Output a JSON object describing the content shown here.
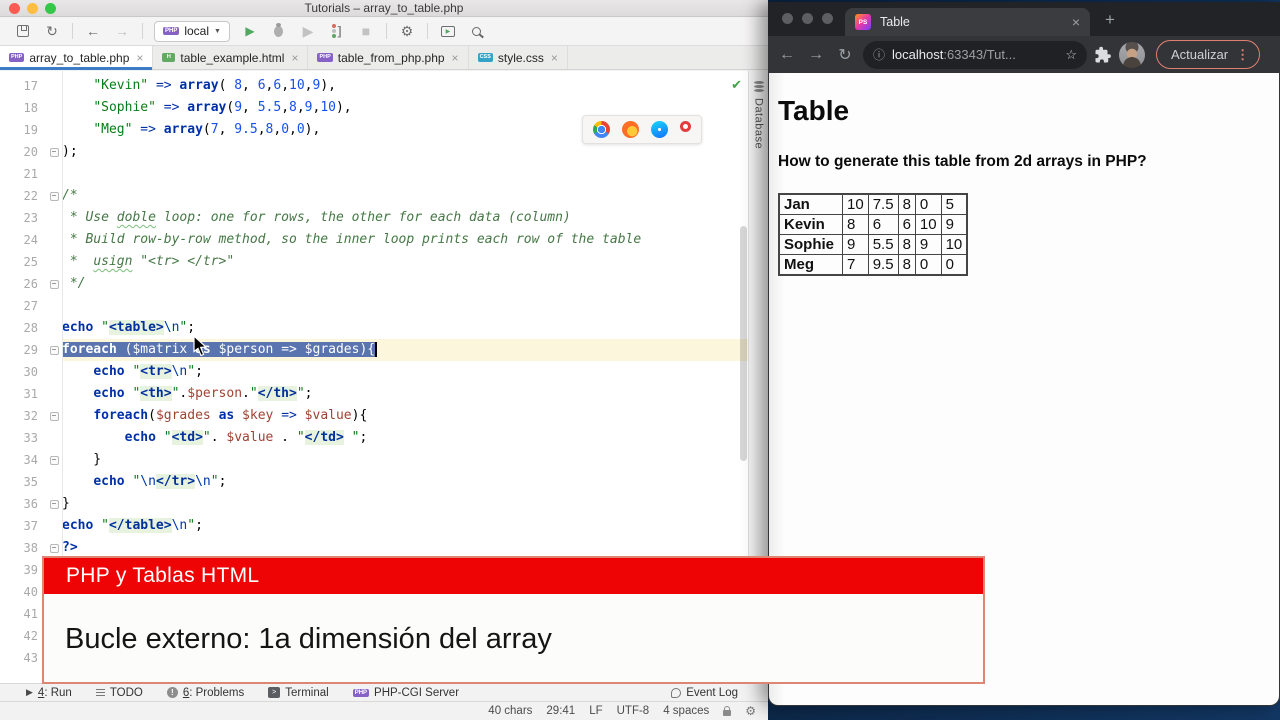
{
  "icons": {
    "back": "←",
    "forward": "→",
    "sync": "↻",
    "play": "▶",
    "coverage": "▶",
    "stop": "■",
    "chevron": "▼",
    "close": "×",
    "plus": "+",
    "dots": "⋮",
    "star": "☆",
    "info": "ⓘ",
    "check": "✔",
    "terminal_glyph": ">_",
    "problem_glyph": "!"
  },
  "ide": {
    "title": "Tutorials – array_to_table.php",
    "toolbar": {
      "run_config": "local",
      "php_badge": "PHP"
    },
    "tabs": [
      {
        "label": "array_to_table.php",
        "type": "php",
        "active": true
      },
      {
        "label": "table_example.html",
        "type": "html",
        "active": false
      },
      {
        "label": "table_from_php.php",
        "type": "php",
        "active": false
      },
      {
        "label": "style.css",
        "type": "css",
        "active": false
      }
    ],
    "database_stripe": "Database",
    "editor": {
      "lines": [
        {
          "n": 17,
          "s": [
            [
              "    ",
              "pl"
            ],
            [
              "\"Kevin\"",
              "str"
            ],
            [
              " ",
              "pl"
            ],
            [
              "=>",
              "op"
            ],
            [
              " ",
              "pl"
            ],
            [
              "array",
              "kw"
            ],
            [
              "( ",
              "pl"
            ],
            [
              "8",
              "num"
            ],
            [
              ", ",
              "pl"
            ],
            [
              "6",
              "num"
            ],
            [
              ",",
              "pl"
            ],
            [
              "6",
              "num"
            ],
            [
              ",",
              "pl"
            ],
            [
              "10",
              "num"
            ],
            [
              ",",
              "pl"
            ],
            [
              "9",
              "num"
            ],
            [
              "),",
              "pl"
            ]
          ]
        },
        {
          "n": 18,
          "s": [
            [
              "    ",
              "pl"
            ],
            [
              "\"Sophie\"",
              "str"
            ],
            [
              " ",
              "pl"
            ],
            [
              "=>",
              "op"
            ],
            [
              " ",
              "pl"
            ],
            [
              "array",
              "kw"
            ],
            [
              "(",
              "pl"
            ],
            [
              "9",
              "num"
            ],
            [
              ", ",
              "pl"
            ],
            [
              "5.5",
              "num"
            ],
            [
              ",",
              "pl"
            ],
            [
              "8",
              "num"
            ],
            [
              ",",
              "pl"
            ],
            [
              "9",
              "num"
            ],
            [
              ",",
              "pl"
            ],
            [
              "10",
              "num"
            ],
            [
              "),",
              "pl"
            ]
          ]
        },
        {
          "n": 19,
          "s": [
            [
              "    ",
              "pl"
            ],
            [
              "\"Meg\"",
              "str"
            ],
            [
              " ",
              "pl"
            ],
            [
              "=>",
              "op"
            ],
            [
              " ",
              "pl"
            ],
            [
              "array",
              "kw"
            ],
            [
              "(",
              "pl"
            ],
            [
              "7",
              "num"
            ],
            [
              ", ",
              "pl"
            ],
            [
              "9.5",
              "num"
            ],
            [
              ",",
              "pl"
            ],
            [
              "8",
              "num"
            ],
            [
              ",",
              "pl"
            ],
            [
              "0",
              "num"
            ],
            [
              ",",
              "pl"
            ],
            [
              "0",
              "num"
            ],
            [
              "),",
              "pl"
            ]
          ]
        },
        {
          "n": 20,
          "fold": true,
          "s": [
            [
              ");",
              "pl"
            ]
          ]
        },
        {
          "n": 21,
          "s": []
        },
        {
          "n": 22,
          "fold": true,
          "s": [
            [
              "/*",
              "cmt"
            ]
          ]
        },
        {
          "n": 23,
          "s": [
            [
              " * Use ",
              "cmt"
            ],
            [
              "doble",
              "cmt typo"
            ],
            [
              " loop: one for rows, the other for each data (column)",
              "cmt"
            ]
          ]
        },
        {
          "n": 24,
          "s": [
            [
              " * Build row-by-row method, so the inner loop prints each row of the table",
              "cmt"
            ]
          ]
        },
        {
          "n": 25,
          "s": [
            [
              " *  ",
              "cmt"
            ],
            [
              "usign",
              "cmt typo"
            ],
            [
              " \"<tr> </tr>\"",
              "cmt"
            ]
          ]
        },
        {
          "n": 26,
          "fold": true,
          "s": [
            [
              " */",
              "cmt"
            ]
          ]
        },
        {
          "n": 27,
          "s": []
        },
        {
          "n": 28,
          "s": [
            [
              "echo",
              "kw"
            ],
            [
              " ",
              "pl"
            ],
            [
              "\"",
              "str"
            ],
            [
              "<table>",
              "tag"
            ],
            [
              "\\n",
              "esc"
            ],
            [
              "\"",
              "str"
            ],
            [
              ";",
              "pl"
            ]
          ]
        },
        {
          "n": 29,
          "fold": true,
          "sel": true,
          "s": [
            [
              "foreach",
              "kw"
            ],
            [
              " (",
              "pl"
            ],
            [
              "$matrix",
              "var"
            ],
            [
              " ",
              "pl"
            ],
            [
              "as",
              "kw"
            ],
            [
              " ",
              "pl"
            ],
            [
              "$person",
              "var"
            ],
            [
              " ",
              "pl"
            ],
            [
              "=>",
              "op"
            ],
            [
              " ",
              "pl"
            ],
            [
              "$grades",
              "var"
            ],
            [
              "){",
              "pl"
            ]
          ]
        },
        {
          "n": 30,
          "s": [
            [
              "    ",
              "pl"
            ],
            [
              "echo",
              "kw"
            ],
            [
              " ",
              "pl"
            ],
            [
              "\"",
              "str"
            ],
            [
              "<tr>",
              "tag"
            ],
            [
              "\\n",
              "esc"
            ],
            [
              "\"",
              "str"
            ],
            [
              ";",
              "pl"
            ]
          ]
        },
        {
          "n": 31,
          "s": [
            [
              "    ",
              "pl"
            ],
            [
              "echo",
              "kw"
            ],
            [
              " ",
              "pl"
            ],
            [
              "\"",
              "str"
            ],
            [
              "<th>",
              "tag"
            ],
            [
              "\"",
              "str"
            ],
            [
              ".",
              "pl"
            ],
            [
              "$person",
              "var"
            ],
            [
              ".",
              "pl"
            ],
            [
              "\"",
              "str"
            ],
            [
              "</th>",
              "tag"
            ],
            [
              "\"",
              "str"
            ],
            [
              ";",
              "pl"
            ]
          ]
        },
        {
          "n": 32,
          "fold": true,
          "s": [
            [
              "    ",
              "pl"
            ],
            [
              "foreach",
              "kw"
            ],
            [
              "(",
              "pl"
            ],
            [
              "$grades",
              "var"
            ],
            [
              " ",
              "pl"
            ],
            [
              "as",
              "kw"
            ],
            [
              " ",
              "pl"
            ],
            [
              "$key",
              "var"
            ],
            [
              " ",
              "pl"
            ],
            [
              "=>",
              "op"
            ],
            [
              " ",
              "pl"
            ],
            [
              "$value",
              "var"
            ],
            [
              "){",
              "pl"
            ]
          ]
        },
        {
          "n": 33,
          "s": [
            [
              "        ",
              "pl"
            ],
            [
              "echo",
              "kw"
            ],
            [
              " ",
              "pl"
            ],
            [
              "\"",
              "str"
            ],
            [
              "<td>",
              "tag"
            ],
            [
              "\"",
              "str"
            ],
            [
              ". ",
              "pl"
            ],
            [
              "$value",
              "var"
            ],
            [
              " . ",
              "pl"
            ],
            [
              "\"",
              "str"
            ],
            [
              "</td>",
              "tag"
            ],
            [
              " \"",
              "str"
            ],
            [
              ";",
              "pl"
            ]
          ]
        },
        {
          "n": 34,
          "fold": true,
          "s": [
            [
              "    }",
              "pl"
            ]
          ]
        },
        {
          "n": 35,
          "s": [
            [
              "    ",
              "pl"
            ],
            [
              "echo",
              "kw"
            ],
            [
              " ",
              "pl"
            ],
            [
              "\"",
              "str"
            ],
            [
              "\\n",
              "esc"
            ],
            [
              "</tr>",
              "tag"
            ],
            [
              "\\n",
              "esc"
            ],
            [
              "\"",
              "str"
            ],
            [
              ";",
              "pl"
            ]
          ]
        },
        {
          "n": 36,
          "fold": true,
          "s": [
            [
              "}",
              "pl"
            ]
          ]
        },
        {
          "n": 37,
          "s": [
            [
              "echo",
              "kw"
            ],
            [
              " ",
              "pl"
            ],
            [
              "\"",
              "str"
            ],
            [
              "</table>",
              "tag"
            ],
            [
              "\\n",
              "esc"
            ],
            [
              "\"",
              "str"
            ],
            [
              ";",
              "pl"
            ]
          ]
        },
        {
          "n": 38,
          "fold": true,
          "s": [
            [
              "?>",
              "kw"
            ]
          ]
        },
        {
          "n": 39,
          "s": []
        },
        {
          "n": 40,
          "s": []
        },
        {
          "n": 41,
          "s": []
        },
        {
          "n": 42,
          "s": []
        },
        {
          "n": 43,
          "s": []
        }
      ]
    },
    "tool_bar": {
      "items": [
        {
          "key": "4",
          "label": "Run",
          "icon": "run"
        },
        {
          "key": "",
          "label": "TODO",
          "icon": "todo"
        },
        {
          "key": "6",
          "label": "Problems",
          "icon": "problems"
        },
        {
          "key": "",
          "label": "Terminal",
          "icon": "terminal"
        },
        {
          "key": "",
          "label": "PHP-CGI Server",
          "icon": "php"
        }
      ],
      "right_label": "Event Log"
    },
    "status_bar": {
      "items": [
        "40 chars",
        "29:41",
        "LF",
        "UTF-8",
        "4 spaces"
      ]
    }
  },
  "browser": {
    "tab_title": "Table",
    "favicon_text": "PS",
    "url": {
      "host": "localhost",
      "rest": ":63343/Tut..."
    },
    "reload_label": "Actualizar",
    "page": {
      "h1": "Table",
      "question": "How to generate this table from 2d arrays in PHP?",
      "table_rows": [
        {
          "name": "Jan",
          "values": [
            "10",
            "7.5",
            "8",
            "0",
            "5"
          ]
        },
        {
          "name": "Kevin",
          "values": [
            "8",
            "6",
            "6",
            "10",
            "9"
          ]
        },
        {
          "name": "Sophie",
          "values": [
            "9",
            "5.5",
            "8",
            "9",
            "10"
          ]
        },
        {
          "name": "Meg",
          "values": [
            "7",
            "9.5",
            "8",
            "0",
            "0"
          ]
        }
      ]
    }
  },
  "caption": {
    "title": "PHP y Tablas HTML",
    "subtitle": "Bucle externo: 1a dimensión del array",
    "accent_color": "#ee0404"
  }
}
